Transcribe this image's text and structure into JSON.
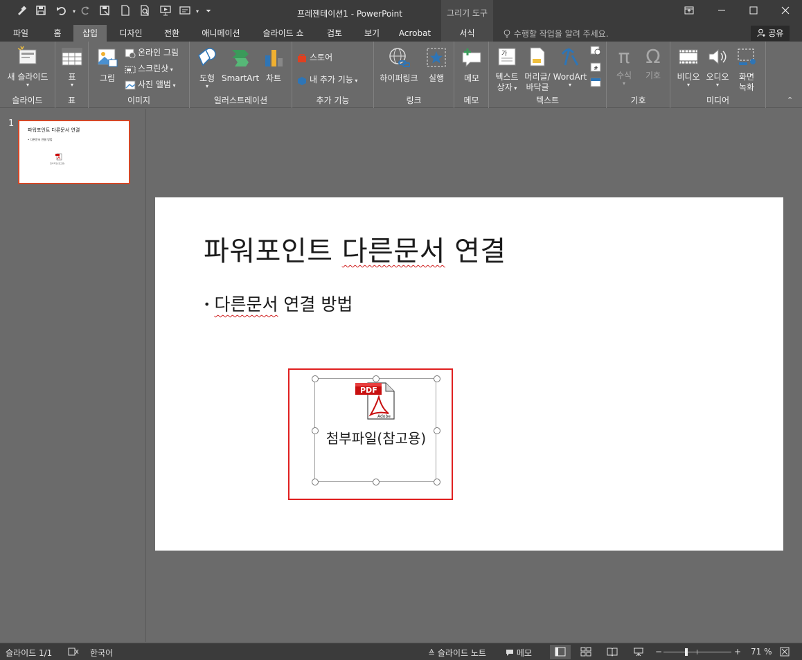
{
  "window": {
    "title": "프레젠테이션1 - PowerPoint",
    "contextual_tab_group": "그리기 도구"
  },
  "tabs": [
    "파일",
    "홈",
    "삽입",
    "디자인",
    "전환",
    "애니메이션",
    "슬라이드 쇼",
    "검토",
    "보기",
    "Acrobat",
    "서식"
  ],
  "active_tab": "삽입",
  "tell_me": "수행할 작업을 알려 주세요.",
  "share": "공유",
  "ribbon": {
    "slides": {
      "label": "슬라이드",
      "new_slide": "새 슬라이드"
    },
    "tables": {
      "label": "표",
      "table": "표"
    },
    "images": {
      "label": "이미지",
      "picture": "그림",
      "online_picture": "온라인 그림",
      "screenshot": "스크린샷",
      "photo_album": "사진 앨범"
    },
    "illustrations": {
      "label": "일러스트레이션",
      "shapes": "도형",
      "smartart": "SmartArt",
      "chart": "차트"
    },
    "addins": {
      "label": "추가 기능",
      "store": "스토어",
      "my_addins": "내 추가 기능"
    },
    "links": {
      "label": "링크",
      "hyperlink": "하이퍼링크",
      "action": "실행"
    },
    "comments": {
      "label": "메모",
      "comment": "메모"
    },
    "text": {
      "label": "텍스트",
      "textbox_1": "텍스트",
      "textbox_2": "상자",
      "header_1": "머리글/",
      "header_2": "바닥글",
      "wordart": "WordArt"
    },
    "symbols": {
      "label": "기호",
      "equation": "수식",
      "symbol": "기호"
    },
    "media": {
      "label": "미디어",
      "video": "비디오",
      "audio": "오디오",
      "screen_rec_1": "화면",
      "screen_rec_2": "녹화"
    }
  },
  "thumbnail": {
    "number": "1",
    "title": "파워포인트 다른문서 연결",
    "bullet": "• 다른문서 연결 방법",
    "caption": "첨부파일(참고용)"
  },
  "slide": {
    "title": "파워포인트 다른문서 연결",
    "title_plain": "파워포인트 ",
    "title_squiggle": "다른문서",
    "title_rest": " 연결",
    "bullet_squiggle": "다른문서",
    "bullet_rest": " 연결 방법",
    "object_caption": "첨부파일(참고용)"
  },
  "statusbar": {
    "slide_count": "슬라이드 1/1",
    "language": "한국어",
    "notes": "슬라이드 노트",
    "comments": "메모",
    "zoom": "71 %"
  },
  "colors": {
    "accent": "#d24726",
    "selection": "#e02020",
    "chrome_dark": "#3b3b3b",
    "ribbon": "#6a6a6a"
  }
}
